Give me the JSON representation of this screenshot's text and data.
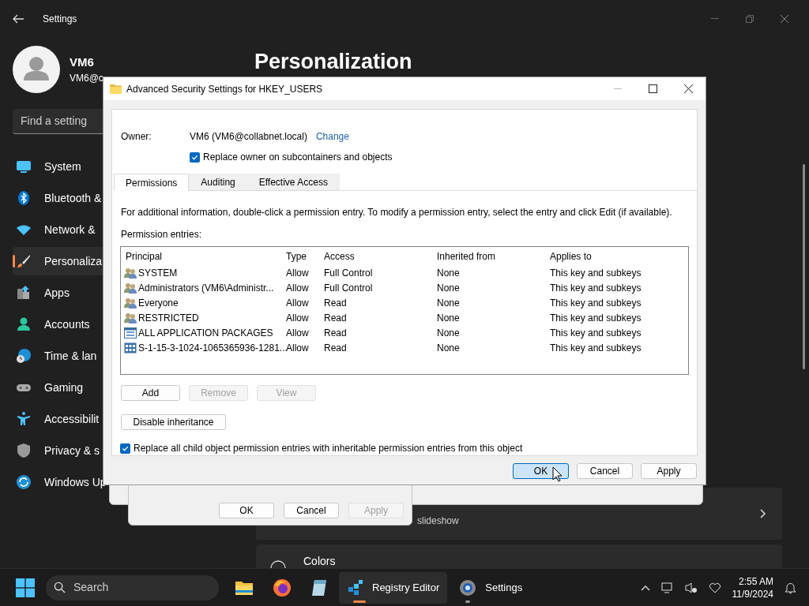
{
  "settings_window": {
    "title": "Settings",
    "user": {
      "name": "VM6",
      "email": "VM6@c"
    },
    "search": {
      "placeholder": "Find a setting"
    },
    "nav": [
      {
        "label": "System",
        "selected": false
      },
      {
        "label": "Bluetooth &",
        "selected": false
      },
      {
        "label": "Network &",
        "selected": false
      },
      {
        "label": "Personaliza",
        "selected": true
      },
      {
        "label": "Apps",
        "selected": false
      },
      {
        "label": "Accounts",
        "selected": false
      },
      {
        "label": "Time & lan",
        "selected": false
      },
      {
        "label": "Gaming",
        "selected": false
      },
      {
        "label": "Accessibilit",
        "selected": false
      },
      {
        "label": "Privacy & s",
        "selected": false
      },
      {
        "label": "Windows Up",
        "selected": false
      }
    ],
    "page_title": "Personalization",
    "card_text": "slideshow",
    "card_label": "Colors"
  },
  "background_dialog": {
    "buttons": [
      {
        "label": "OK",
        "disabled": false
      },
      {
        "label": "Cancel",
        "disabled": false
      },
      {
        "label": "Apply",
        "disabled": true
      }
    ]
  },
  "dialog": {
    "title": "Advanced Security Settings for HKEY_USERS",
    "owner_label": "Owner:",
    "owner_value": "VM6 (VM6@collabnet.local)",
    "change_link": "Change",
    "replace_owner": {
      "label": "Replace owner on subcontainers and objects",
      "checked": true
    },
    "tabs": [
      {
        "label": "Permissions",
        "selected": true
      },
      {
        "label": "Auditing",
        "selected": false
      },
      {
        "label": "Effective Access",
        "selected": false
      }
    ],
    "info": "For additional information, double-click a permission entry. To modify a permission entry, select the entry and click Edit (if available).",
    "entries_label": "Permission entries:",
    "table": {
      "columns": [
        "Principal",
        "Type",
        "Access",
        "Inherited from",
        "Applies to"
      ],
      "rows": [
        {
          "kind": "group",
          "cells": [
            "SYSTEM",
            "Allow",
            "Full Control",
            "None",
            "This key and subkeys"
          ]
        },
        {
          "kind": "group",
          "cells": [
            "Administrators (VM6\\Administr...",
            "Allow",
            "Full Control",
            "None",
            "This key and subkeys"
          ]
        },
        {
          "kind": "group",
          "cells": [
            "Everyone",
            "Allow",
            "Read",
            "None",
            "This key and subkeys"
          ]
        },
        {
          "kind": "group",
          "cells": [
            "RESTRICTED",
            "Allow",
            "Read",
            "None",
            "This key and subkeys"
          ]
        },
        {
          "kind": "package",
          "cells": [
            "ALL APPLICATION PACKAGES",
            "Allow",
            "Read",
            "None",
            "This key and subkeys"
          ]
        },
        {
          "kind": "sid",
          "cells": [
            "S-1-15-3-1024-1065365936-1281...",
            "Allow",
            "Read",
            "None",
            "This key and subkeys"
          ]
        }
      ]
    },
    "entry_buttons": [
      {
        "label": "Add",
        "disabled": false
      },
      {
        "label": "Remove",
        "disabled": true
      },
      {
        "label": "View",
        "disabled": true
      }
    ],
    "disable_inheritance": "Disable inheritance",
    "replace_child": {
      "label": "Replace all child object permission entries with inheritable permission entries from this object",
      "checked": true
    },
    "footer_buttons": [
      {
        "label": "OK",
        "focused": true
      },
      {
        "label": "Cancel",
        "focused": false
      },
      {
        "label": "Apply",
        "focused": false
      }
    ]
  },
  "taskbar": {
    "search": "Search",
    "apps": [
      {
        "active": false,
        "running": false
      },
      {
        "active": false,
        "running": false
      },
      {
        "active": false,
        "running": false
      },
      {
        "label": "Registry Editor",
        "active": true,
        "running": true
      },
      {
        "label": "Settings",
        "active": false,
        "running": true
      }
    ],
    "time": "2:55 AM",
    "date": "11/9/2024"
  }
}
